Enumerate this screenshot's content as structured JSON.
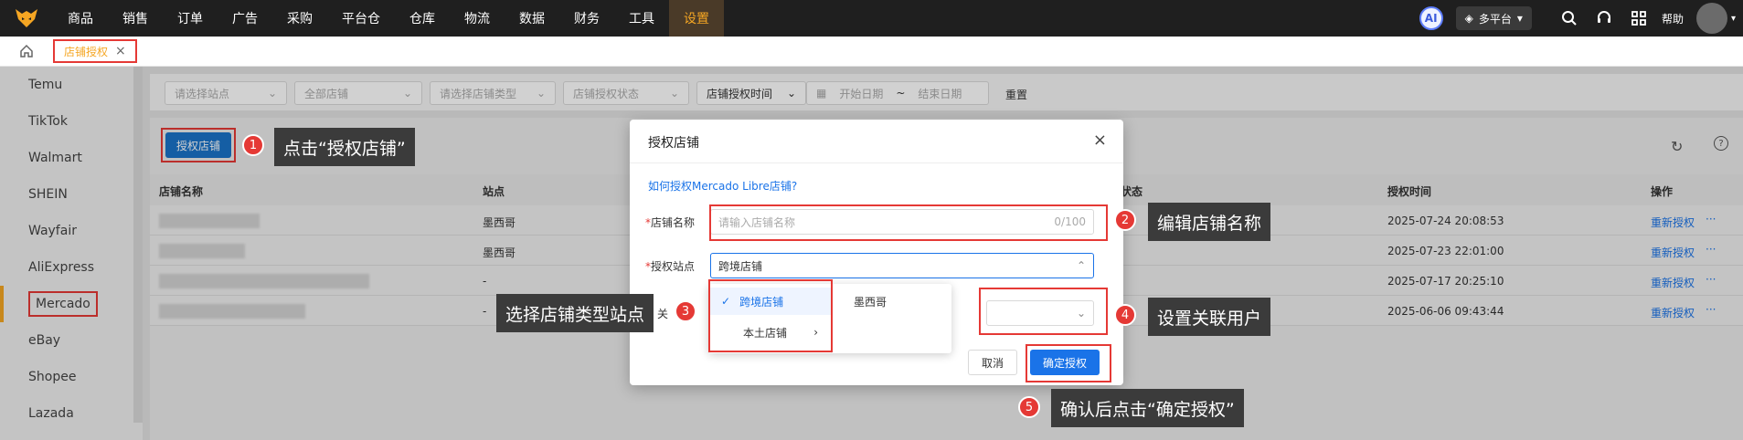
{
  "topbar": {
    "nav": [
      "商品",
      "销售",
      "订单",
      "广告",
      "采购",
      "平台仓",
      "仓库",
      "物流",
      "数据",
      "财务",
      "工具",
      "设置"
    ],
    "active_index": 11,
    "ai_label": "AI",
    "platform_label": "多平台",
    "help_label": "帮助"
  },
  "tabs": {
    "current": "店铺授权",
    "close": "×"
  },
  "sidebar": {
    "items": [
      "Temu",
      "TikTok",
      "Walmart",
      "SHEIN",
      "Wayfair",
      "AliExpress",
      "Mercado",
      "eBay",
      "Shopee",
      "Lazada"
    ],
    "active_index": 6
  },
  "filters": {
    "site": "请选择站点",
    "shops": "全部店铺",
    "shop_type": "请选择店铺类型",
    "auth_status": "店铺授权状态",
    "time_field": "店铺授权时间",
    "start_date": "开始日期",
    "range_sep": "~",
    "end_date": "结束日期",
    "reset": "重置"
  },
  "toolbar": {
    "auth_button": "授权店铺"
  },
  "table": {
    "headers": {
      "name": "店铺名称",
      "site": "站点",
      "status": "状态",
      "auth_time": "授权时间",
      "ops": "操作"
    },
    "rows": [
      {
        "site": "墨西哥",
        "time": "2025-07-24 20:08:53",
        "op": "重新授权",
        "more": "···"
      },
      {
        "site": "墨西哥",
        "time": "2025-07-23 22:01:00",
        "op": "重新授权",
        "more": "···"
      },
      {
        "site": "-",
        "time": "2025-07-17 20:25:10",
        "op": "重新授权",
        "more": "···"
      },
      {
        "site": "-",
        "time": "2025-06-06 09:43:44",
        "op": "重新授权",
        "more": "···"
      }
    ]
  },
  "modal": {
    "title": "授权店铺",
    "close": "×",
    "help_link": "如何授权Mercado Libre店铺?",
    "name_label": "店铺名称",
    "name_placeholder": "请输入店铺名称",
    "name_count": "0/100",
    "site_label": "授权站点",
    "site_value": "跨境店铺",
    "user_label_partial": "关",
    "cancel": "取消",
    "confirm": "确定授权",
    "required_mark": "*"
  },
  "dropdown": {
    "left": [
      {
        "label": "跨境店铺",
        "selected": true
      },
      {
        "label": "本土店铺",
        "selected": false
      }
    ],
    "right": [
      "墨西哥"
    ]
  },
  "annotations": {
    "step1": {
      "num": "1",
      "text": "点击“授权店铺”"
    },
    "step2": {
      "num": "2",
      "text": "编辑店铺名称"
    },
    "step3": {
      "num": "3",
      "text": "选择店铺类型站点"
    },
    "step4": {
      "num": "4",
      "text": "设置关联用户"
    },
    "step5": {
      "num": "5",
      "text": "确认后点击“确定授权”"
    }
  },
  "colors": {
    "accent": "#f5a623",
    "primary": "#1a73e8",
    "annotation_red": "#e53935"
  }
}
